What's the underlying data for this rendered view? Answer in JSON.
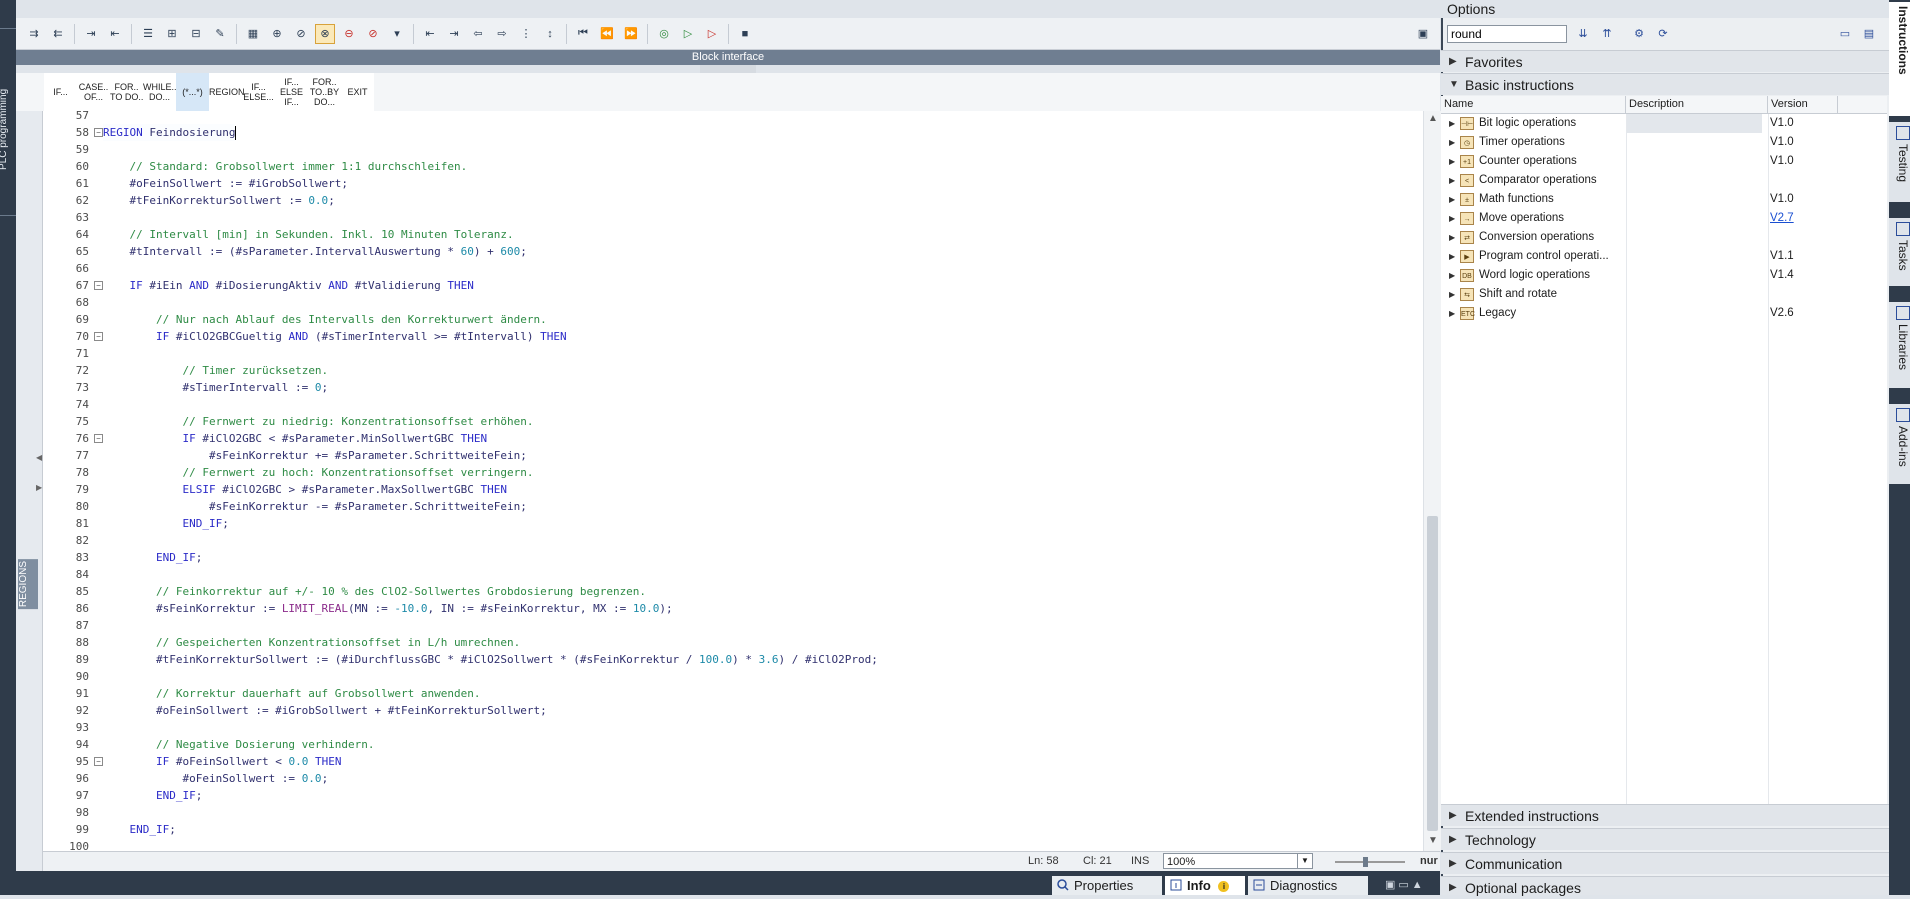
{
  "sidebar": {
    "plc_programming": "PLC programming",
    "regions": "REGIONS"
  },
  "toolbar": {
    "icons": [
      "insert-network-icon",
      "delete-network-icon",
      "insert-row-icon",
      "add-row-icon",
      "delete-row-icon",
      "insert-block-icon",
      "close-all-icon",
      "open-all-icon",
      "comment-icon",
      "uncomment-icon",
      "absolute-operands-icon",
      "favorites-icon",
      "breakpoint-icon",
      "breakpoint-delete-icon",
      "indent-icon",
      "outdent-icon",
      "increase-indent-icon",
      "decrease-indent-icon",
      "line-numbers-icon",
      "sort-icon",
      "jump-first-icon",
      "jump-prev-icon",
      "jump-next-icon",
      "monitor-icon",
      "compare-icon",
      "test-icon",
      "download-icon"
    ]
  },
  "block_interface": "Block interface",
  "templates": [
    {
      "label": "IF..."
    },
    {
      "label": "CASE..\nOF..."
    },
    {
      "label": "FOR..\nTO DO.."
    },
    {
      "label": "WHILE..\nDO..."
    },
    {
      "label": "(*...*)"
    },
    {
      "label": "REGION"
    },
    {
      "label": "IF...\nELSE..."
    },
    {
      "label": "IF...\nELSE\nIF..."
    },
    {
      "label": "FOR..\nTO..BY\nDO..."
    },
    {
      "label": "EXIT"
    }
  ],
  "code": {
    "lines": [
      {
        "n": "57",
        "parts": []
      },
      {
        "n": "58",
        "fold": "-",
        "parts": [
          [
            "kw",
            "REGION"
          ],
          [
            "",
            "Feindosierung"
          ]
        ]
      },
      {
        "n": "59",
        "parts": []
      },
      {
        "n": "60",
        "parts": [
          [
            "",
            "    "
          ],
          [
            "cm",
            "// Standard: Grobsollwert immer 1:1 durchschleifen."
          ]
        ]
      },
      {
        "n": "61",
        "parts": [
          [
            "",
            "    #oFeinSollwert := #iGrobSollwert;"
          ]
        ]
      },
      {
        "n": "62",
        "parts": [
          [
            "",
            "    #tFeinKorrekturSollwert := "
          ],
          [
            "num",
            "0.0"
          ],
          [
            "",
            ";"
          ]
        ]
      },
      {
        "n": "63",
        "parts": []
      },
      {
        "n": "64",
        "parts": [
          [
            "",
            "    "
          ],
          [
            "cm",
            "// Intervall [min] in Sekunden. Inkl. 10 Minuten Toleranz."
          ]
        ]
      },
      {
        "n": "65",
        "parts": [
          [
            "",
            "    #tIntervall := (#sParameter.IntervallAuswertung * "
          ],
          [
            "num",
            "60"
          ],
          [
            "",
            ") + "
          ],
          [
            "num",
            "600"
          ],
          [
            "",
            ";"
          ]
        ]
      },
      {
        "n": "66",
        "parts": []
      },
      {
        "n": "67",
        "fold": "-",
        "parts": [
          [
            "",
            "    "
          ],
          [
            "kw",
            "IF"
          ],
          [
            "",
            " #iEin "
          ],
          [
            "kw",
            "AND"
          ],
          [
            "",
            " #iDosierungAktiv "
          ],
          [
            "kw",
            "AND"
          ],
          [
            "",
            " #tValidierung "
          ],
          [
            "kw",
            "THEN"
          ]
        ]
      },
      {
        "n": "68",
        "parts": []
      },
      {
        "n": "69",
        "parts": [
          [
            "",
            "        "
          ],
          [
            "cm",
            "// Nur nach Ablauf des Intervalls den Korrekturwert ändern."
          ]
        ]
      },
      {
        "n": "70",
        "fold": "-",
        "parts": [
          [
            "",
            "        "
          ],
          [
            "kw",
            "IF"
          ],
          [
            "",
            " #iClO2GBCGueltig "
          ],
          [
            "kw",
            "AND"
          ],
          [
            "",
            " (#sTimerIntervall >= #tIntervall) "
          ],
          [
            "kw",
            "THEN"
          ]
        ]
      },
      {
        "n": "71",
        "parts": []
      },
      {
        "n": "72",
        "parts": [
          [
            "",
            "            "
          ],
          [
            "cm",
            "// Timer zurücksetzen."
          ]
        ]
      },
      {
        "n": "73",
        "parts": [
          [
            "",
            "            #sTimerIntervall := "
          ],
          [
            "num",
            "0"
          ],
          [
            "",
            ";"
          ]
        ]
      },
      {
        "n": "74",
        "parts": []
      },
      {
        "n": "75",
        "parts": [
          [
            "",
            "            "
          ],
          [
            "cm",
            "// Fernwert zu niedrig: Konzentrationsoffset erhöhen."
          ]
        ]
      },
      {
        "n": "76",
        "fold": "-",
        "parts": [
          [
            "",
            "            "
          ],
          [
            "kw",
            "IF"
          ],
          [
            "",
            " #iClO2GBC < #sParameter.MinSollwertGBC "
          ],
          [
            "kw",
            "THEN"
          ]
        ]
      },
      {
        "n": "77",
        "parts": [
          [
            "",
            "                #sFeinKorrektur += #sParameter.SchrittweiteFein;"
          ]
        ]
      },
      {
        "n": "78",
        "parts": [
          [
            "",
            "            "
          ],
          [
            "cm",
            "// Fernwert zu hoch: Konzentrationsoffset verringern."
          ]
        ]
      },
      {
        "n": "79",
        "parts": [
          [
            "",
            "            "
          ],
          [
            "kw",
            "ELSIF"
          ],
          [
            "",
            " #iClO2GBC > #sParameter.MaxSollwertGBC "
          ],
          [
            "kw",
            "THEN"
          ]
        ]
      },
      {
        "n": "80",
        "parts": [
          [
            "",
            "                #sFeinKorrektur -= #sParameter.SchrittweiteFein;"
          ]
        ]
      },
      {
        "n": "81",
        "parts": [
          [
            "",
            "            "
          ],
          [
            "kw",
            "END_IF"
          ],
          [
            "",
            ";"
          ]
        ]
      },
      {
        "n": "82",
        "parts": []
      },
      {
        "n": "83",
        "parts": [
          [
            "",
            "        "
          ],
          [
            "kw",
            "END_IF"
          ],
          [
            "",
            ";"
          ]
        ]
      },
      {
        "n": "84",
        "parts": []
      },
      {
        "n": "85",
        "parts": [
          [
            "",
            "        "
          ],
          [
            "cm",
            "// Feinkorrektur auf +/- 10 % des ClO2-Sollwertes Grobdosierung begrenzen."
          ]
        ]
      },
      {
        "n": "86",
        "parts": [
          [
            "",
            "        #sFeinKorrektur := "
          ],
          [
            "fn",
            "LIMIT_REAL"
          ],
          [
            "",
            "(MN := "
          ],
          [
            "num",
            "-10.0"
          ],
          [
            "",
            ", IN := #sFeinKorrektur, MX := "
          ],
          [
            "num",
            "10.0"
          ],
          [
            "",
            ");"
          ]
        ]
      },
      {
        "n": "87",
        "parts": []
      },
      {
        "n": "88",
        "parts": [
          [
            "",
            "        "
          ],
          [
            "cm",
            "// Gespeicherten Konzentrationsoffset in L/h umrechnen."
          ]
        ]
      },
      {
        "n": "89",
        "parts": [
          [
            "",
            "        #tFeinKorrekturSollwert := (#iDurchflussGBC * #iClO2Sollwert * (#sFeinKorrektur / "
          ],
          [
            "num",
            "100.0"
          ],
          [
            "",
            ") * "
          ],
          [
            "num",
            "3.6"
          ],
          [
            "",
            ") / #iClO2Prod;"
          ]
        ]
      },
      {
        "n": "90",
        "parts": []
      },
      {
        "n": "91",
        "parts": [
          [
            "",
            "        "
          ],
          [
            "cm",
            "// Korrektur dauerhaft auf Grobsollwert anwenden."
          ]
        ]
      },
      {
        "n": "92",
        "parts": [
          [
            "",
            "        #oFeinSollwert := #iGrobSollwert + #tFeinKorrekturSollwert;"
          ]
        ]
      },
      {
        "n": "93",
        "parts": []
      },
      {
        "n": "94",
        "parts": [
          [
            "",
            "        "
          ],
          [
            "cm",
            "// Negative Dosierung verhindern."
          ]
        ]
      },
      {
        "n": "95",
        "fold": "-",
        "parts": [
          [
            "",
            "        "
          ],
          [
            "kw",
            "IF"
          ],
          [
            "",
            " #oFeinSollwert < "
          ],
          [
            "num",
            "0.0"
          ],
          [
            "",
            " "
          ],
          [
            "kw",
            "THEN"
          ]
        ]
      },
      {
        "n": "96",
        "parts": [
          [
            "",
            "            #oFeinSollwert := "
          ],
          [
            "num",
            "0.0"
          ],
          [
            "",
            ";"
          ]
        ]
      },
      {
        "n": "97",
        "parts": [
          [
            "",
            "        "
          ],
          [
            "kw",
            "END_IF"
          ],
          [
            "",
            ";"
          ]
        ]
      },
      {
        "n": "98",
        "parts": []
      },
      {
        "n": "99",
        "parts": [
          [
            "",
            "    "
          ],
          [
            "kw",
            "END_IF"
          ],
          [
            "",
            ";"
          ]
        ]
      },
      {
        "n": "100",
        "parts": []
      }
    ]
  },
  "status": {
    "ln": "Ln: 58",
    "cl": "Cl: 21",
    "ins": "INS",
    "zoom": "100%",
    "cut": "nur"
  },
  "bottom_tabs": {
    "properties": "Properties",
    "info": "Info",
    "diagnostics": "Diagnostics"
  },
  "options": {
    "title": "Options",
    "search_value": "round",
    "sections": {
      "favorites": "Favorites",
      "basic": "Basic instructions",
      "extended": "Extended instructions",
      "technology": "Technology",
      "communication": "Communication",
      "optional": "Optional packages"
    },
    "columns": {
      "name": "Name",
      "description": "Description",
      "version": "Version"
    },
    "rows": [
      {
        "name": "Bit logic operations",
        "version": "V1.0",
        "icon": "bit-logic-icon",
        "glyph": "⊣⊢"
      },
      {
        "name": "Timer operations",
        "version": "V1.0",
        "icon": "timer-icon",
        "glyph": "◷"
      },
      {
        "name": "Counter operations",
        "version": "V1.0",
        "icon": "counter-icon",
        "glyph": "+1"
      },
      {
        "name": "Comparator operations",
        "version": "",
        "icon": "comparator-icon",
        "glyph": "<"
      },
      {
        "name": "Math functions",
        "version": "V1.0",
        "icon": "math-icon",
        "glyph": "±"
      },
      {
        "name": "Move operations",
        "version": "V2.7",
        "icon": "move-icon",
        "glyph": "→"
      },
      {
        "name": "Conversion operations",
        "version": "",
        "icon": "conversion-icon",
        "glyph": "⇄"
      },
      {
        "name": "Program control operati...",
        "version": "V1.1",
        "icon": "program-control-icon",
        "glyph": "▶"
      },
      {
        "name": "Word logic operations",
        "version": "V1.4",
        "icon": "word-logic-icon",
        "glyph": "DB"
      },
      {
        "name": "Shift and rotate",
        "version": "",
        "icon": "shift-rotate-icon",
        "glyph": "⇆"
      },
      {
        "name": "Legacy",
        "version": "V2.6",
        "icon": "legacy-icon",
        "glyph": "ETC"
      }
    ]
  },
  "vtabs": {
    "instructions": "Instructions",
    "testing": "Testing",
    "tasks": "Tasks",
    "libraries": "Libraries",
    "addins": "Add-ins"
  }
}
